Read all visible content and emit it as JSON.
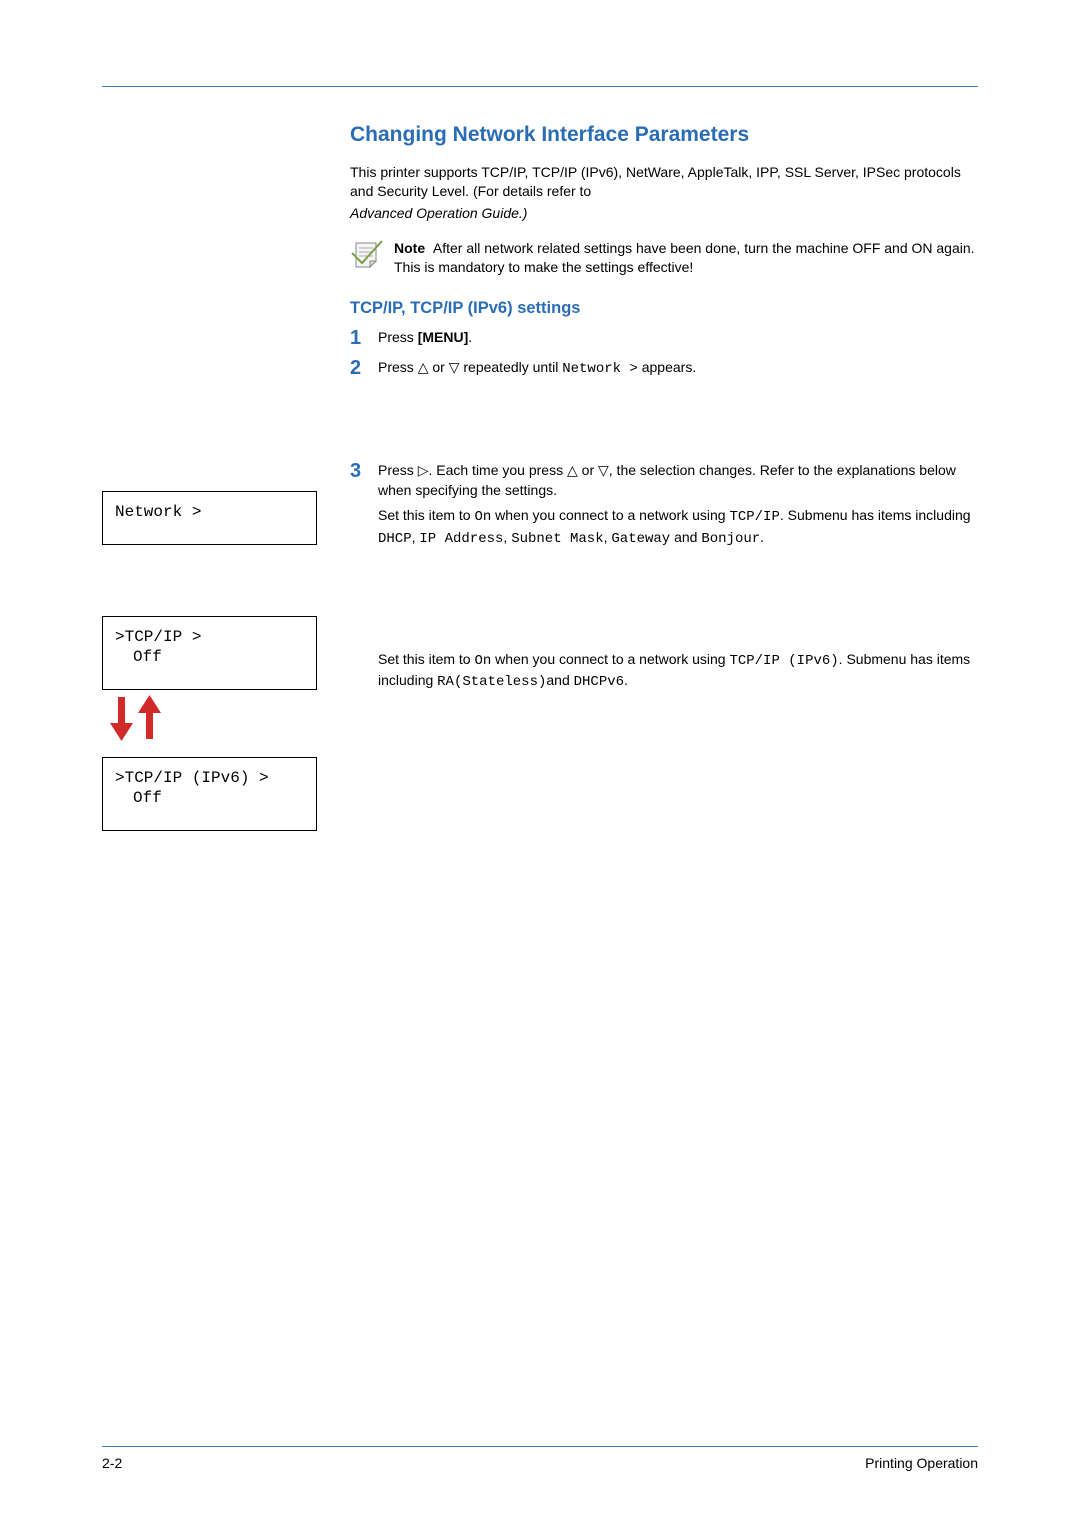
{
  "heading": "Changing Network Interface Parameters",
  "intro": "This printer supports TCP/IP, TCP/IP (IPv6), NetWare, AppleTalk, IPP, SSL Server, IPSec protocols and Security Level. (For details refer to",
  "intro_italic": "Advanced Operation Guide.)",
  "note_label": "Note",
  "note_text": "After all network related settings have been done, turn the machine OFF and ON again. This is mandatory to make the settings effective!",
  "subsection": "TCP/IP, TCP/IP (IPv6) settings",
  "steps": {
    "s1": {
      "num": "1",
      "pre": "Press ",
      "bold": "[MENU]",
      "post": "."
    },
    "s2": {
      "num": "2",
      "pre": "Press ",
      "mid": " or ",
      "mid2": " repeatedly until ",
      "code": "Network >",
      "post": "appears."
    },
    "s3": {
      "num": "3",
      "p1a": "Press ",
      "p1b": ". Each time you press ",
      "p1c": " or ",
      "p1d": ", the selection changes. Refer to the explanations below when specifying the settings."
    }
  },
  "explain1": {
    "a": "Set this item to ",
    "on": "On",
    "b": " when you connect to a network using ",
    "tcp": "TCP/IP",
    "c": ". Submenu has items including ",
    "i1": "DHCP",
    "sep1": ", ",
    "i2": "IP Address",
    "sep2": ", ",
    "i3": "Subnet Mask",
    "sep3": ", ",
    "i4": "Gateway",
    "and": " and ",
    "i5": "Bonjour",
    "end": "."
  },
  "explain2": {
    "a": "Set this item to ",
    "on": "On",
    "b": " when you connect to a network using ",
    "tcp6": "TCP/IP (IPv6)",
    "c": ". Submenu has items including ",
    "i1": "RA(Stateless)",
    "and": "and ",
    "i2": "DHCPv6",
    "end": "."
  },
  "lcd": {
    "l1": "Network         >",
    "l2a": ">TCP/IP         >",
    "l2b": "Off",
    "l3a": ">TCP/IP (IPv6)  >",
    "l3b": "Off"
  },
  "footer": {
    "page": "2-2",
    "section": "Printing Operation"
  }
}
